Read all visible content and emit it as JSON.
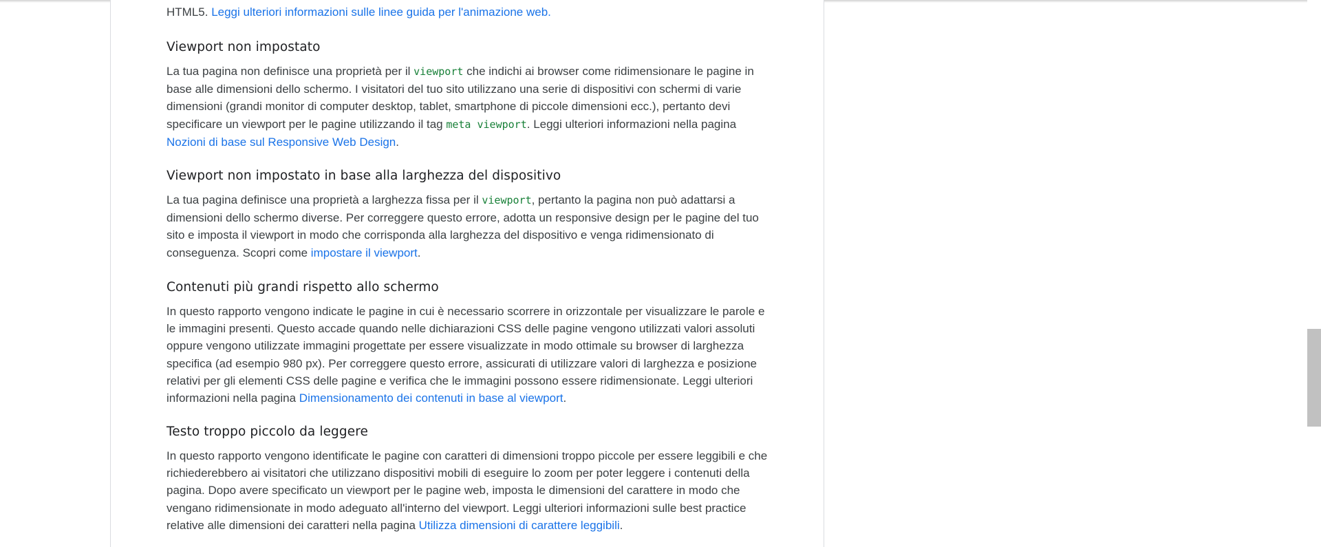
{
  "top_fragment": {
    "pre": "HTML5. ",
    "link": "Leggi ulteriori informazioni sulle linee guida per l'animazione web."
  },
  "sections": [
    {
      "title": "Viewport non impostato",
      "parts": [
        {
          "t": "text",
          "v": "La tua pagina non definisce una proprietà per il "
        },
        {
          "t": "code",
          "v": "viewport"
        },
        {
          "t": "text",
          "v": " che indichi ai browser come ridimensionare le pagine in base alle dimensioni dello schermo. I visitatori del tuo sito utilizzano una serie di dispositivi con schermi di varie dimensioni (grandi monitor di computer desktop, tablet, smartphone di piccole dimensioni ecc.), pertanto devi specificare un viewport per le pagine utilizzando il tag "
        },
        {
          "t": "code",
          "v": "meta viewport"
        },
        {
          "t": "text",
          "v": ". Leggi ulteriori informazioni nella pagina "
        },
        {
          "t": "link",
          "v": "Nozioni di base sul Responsive Web Design"
        },
        {
          "t": "text",
          "v": "."
        }
      ]
    },
    {
      "title": "Viewport non impostato in base alla larghezza del dispositivo",
      "parts": [
        {
          "t": "text",
          "v": "La tua pagina definisce una proprietà a larghezza fissa per il "
        },
        {
          "t": "code",
          "v": "viewport"
        },
        {
          "t": "text",
          "v": ", pertanto la pagina non può adattarsi a dimensioni dello schermo diverse. Per correggere questo errore, adotta un responsive design per le pagine del tuo sito e imposta il viewport in modo che corrisponda alla larghezza del dispositivo e venga ridimensionato di conseguenza. Scopri come "
        },
        {
          "t": "link",
          "v": "impostare il viewport"
        },
        {
          "t": "text",
          "v": "."
        }
      ]
    },
    {
      "title": "Contenuti più grandi rispetto allo schermo",
      "parts": [
        {
          "t": "text",
          "v": "In questo rapporto vengono indicate le pagine in cui è necessario scorrere in orizzontale per visualizzare le parole e le immagini presenti. Questo accade quando nelle dichiarazioni CSS delle pagine vengono utilizzati valori assoluti oppure vengono utilizzate immagini progettate per essere visualizzate in modo ottimale su browser di larghezza specifica (ad esempio 980 px). Per correggere questo errore, assicurati di utilizzare valori di larghezza e posizione relativi per gli elementi CSS delle pagine e verifica che le immagini possono essere ridimensionate. Leggi ulteriori informazioni nella pagina "
        },
        {
          "t": "link",
          "v": "Dimensionamento dei contenuti in base al viewport"
        },
        {
          "t": "text",
          "v": "."
        }
      ]
    },
    {
      "title": "Testo troppo piccolo da leggere",
      "parts": [
        {
          "t": "text",
          "v": "In questo rapporto vengono identificate le pagine con caratteri di dimensioni troppo piccole per essere leggibili e che richiederebbero ai visitatori che utilizzano dispositivi mobili di eseguire lo zoom per poter leggere i contenuti della pagina. Dopo avere specificato un viewport per le pagine web, imposta le dimensioni del carattere in modo che vengano ridimensionate in modo adeguato all'interno del viewport. Leggi ulteriori informazioni sulle best practice relative alle dimensioni dei caratteri nella pagina "
        },
        {
          "t": "link",
          "v": "Utilizza dimensioni di carattere leggibili"
        },
        {
          "t": "text",
          "v": "."
        }
      ]
    }
  ]
}
